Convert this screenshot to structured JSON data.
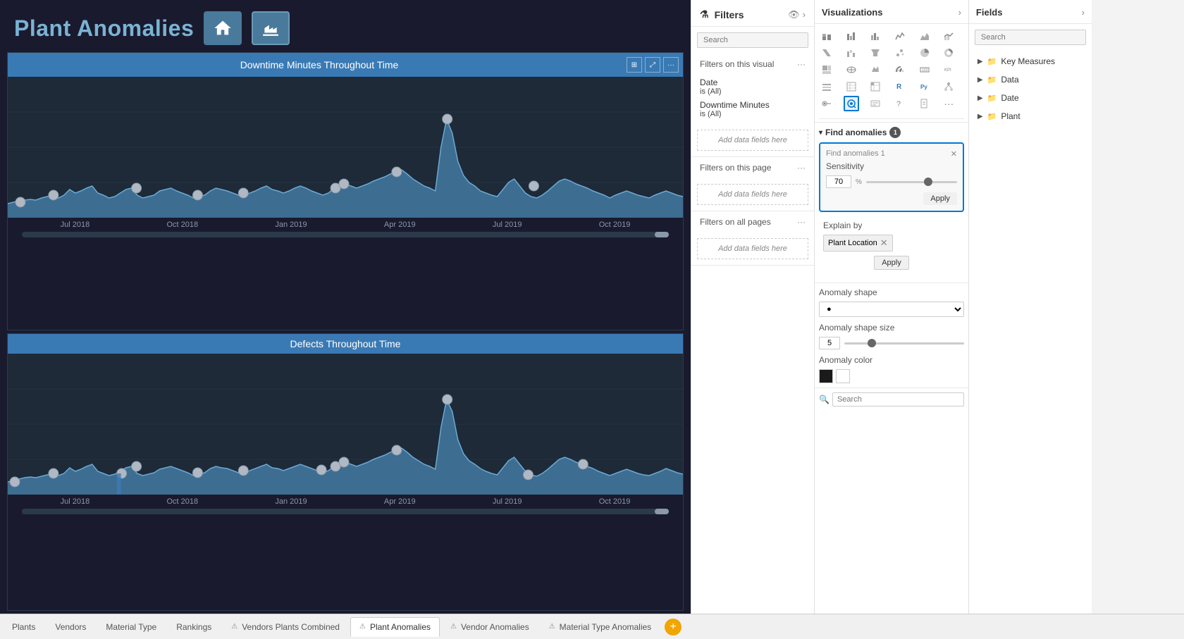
{
  "canvas": {
    "title": "Plant Anomalies",
    "chart1": {
      "title": "Downtime Minutes Throughout Time",
      "axisLabels": [
        "Jul 2018",
        "Oct 2018",
        "Jan 2019",
        "Apr 2019",
        "Jul 2019",
        "Oct 2019"
      ]
    },
    "chart2": {
      "title": "Defects Throughout Time",
      "axisLabels": [
        "Jul 2018",
        "Oct 2018",
        "Jan 2019",
        "Apr 2019",
        "Jul 2019",
        "Oct 2019"
      ]
    }
  },
  "filters": {
    "title": "Filters",
    "searchPlaceholder": "Search",
    "sections": [
      {
        "label": "Filters on this visual",
        "items": [
          {
            "name": "Date",
            "value": "is (All)"
          },
          {
            "name": "Downtime Minutes",
            "value": "is (All)"
          }
        ],
        "addLabel": "Add data fields here"
      },
      {
        "label": "Filters on this page",
        "addLabel": "Add data fields here"
      },
      {
        "label": "Filters on all pages",
        "addLabel": "Add data fields here"
      }
    ]
  },
  "visualizations": {
    "title": "Visualizations",
    "searchPlaceholder": "Search",
    "icons": [
      "bar-chart",
      "stacked-bar",
      "cluster-bar",
      "column-chart",
      "stacked-column",
      "cluster-column",
      "line-chart",
      "area-chart",
      "combo-chart",
      "scatter",
      "pie-chart",
      "donut-chart",
      "map",
      "filled-map",
      "treemap",
      "funnel",
      "gauge",
      "card",
      "table",
      "matrix",
      "waterfall",
      "ribbon",
      "kpi",
      "slicer",
      "py-icon",
      "r-icon",
      "shape",
      "image",
      "text",
      "button",
      "decomp",
      "key-influencers",
      "anomaly-detect",
      "smart-narrative",
      "qna",
      "paginated"
    ],
    "selectedIcon": "anomaly-detect"
  },
  "findAnomalies": {
    "label": "Find anomalies",
    "badge": "1",
    "configTitle": "Find anomalies 1",
    "sensitivity": {
      "label": "Sensitivity",
      "value": "70",
      "unit": "%"
    },
    "applyLabel": "Apply",
    "explainBy": {
      "label": "Explain by",
      "tag": "Plant Location",
      "applyLabel": "Apply"
    },
    "anomalyShape": {
      "label": "Anomaly shape",
      "value": "●",
      "options": [
        "●",
        "■",
        "▲",
        "◆"
      ]
    },
    "anomalyShapeSize": {
      "label": "Anomaly shape size",
      "value": "5"
    },
    "anomalyColor": {
      "label": "Anomaly color"
    }
  },
  "fields": {
    "title": "Fields",
    "searchPlaceholder": "Search",
    "groups": [
      {
        "label": "Key Measures",
        "icon": "📁"
      },
      {
        "label": "Data",
        "icon": "📁"
      },
      {
        "label": "Date",
        "icon": "📁"
      },
      {
        "label": "Plant",
        "icon": "📁"
      }
    ]
  },
  "tabs": [
    {
      "label": "Plants",
      "active": false,
      "icon": ""
    },
    {
      "label": "Vendors",
      "active": false,
      "icon": ""
    },
    {
      "label": "Material Type",
      "active": false,
      "icon": ""
    },
    {
      "label": "Rankings",
      "active": false,
      "icon": ""
    },
    {
      "label": "Vendors Plants Combined",
      "active": false,
      "icon": "⚠"
    },
    {
      "label": "Plant Anomalies",
      "active": true,
      "icon": "⚠"
    },
    {
      "label": "Vendor Anomalies",
      "active": false,
      "icon": "⚠"
    },
    {
      "label": "Material Type Anomalies",
      "active": false,
      "icon": "⚠"
    }
  ],
  "addTabLabel": "+"
}
